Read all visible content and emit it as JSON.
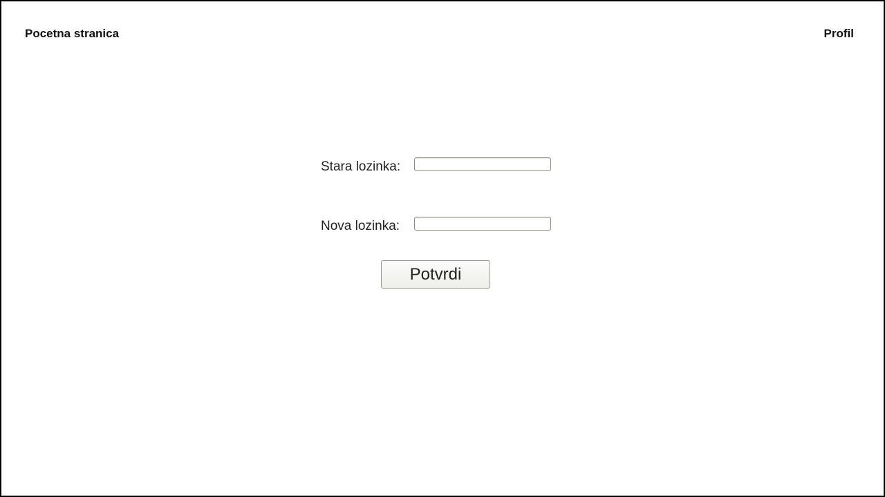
{
  "nav": {
    "home_label": "Pocetna stranica",
    "profile_label": "Profil"
  },
  "form": {
    "old_password_label": "Stara lozinka:",
    "old_password_value": "",
    "new_password_label": "Nova lozinka:",
    "new_password_value": "",
    "submit_label": "Potvrdi"
  }
}
